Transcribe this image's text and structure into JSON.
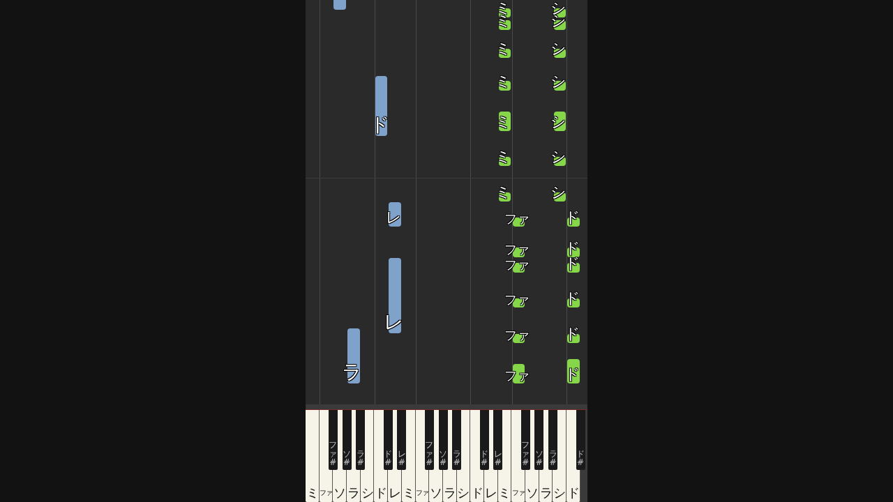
{
  "piano_roll": {
    "notes": [
      {
        "color": "#7fa2cb"
      },
      {
        "color": "#7fa2cb",
        "label": "ド"
      },
      {
        "color": "#7fa2cb",
        "label": "レ"
      },
      {
        "color": "#7fa2cb",
        "label": "レ"
      },
      {
        "color": "#7fa2cb",
        "label": "ラ"
      },
      {
        "color": "#86d64a",
        "label": "ミ"
      },
      {
        "color": "#86d64a",
        "label": "ミ"
      },
      {
        "color": "#86d64a",
        "label": "ミ"
      },
      {
        "color": "#86d64a",
        "label": "ミ"
      },
      {
        "color": "#86d64a",
        "label": "ミ"
      },
      {
        "color": "#86d64a",
        "label": "ミ"
      },
      {
        "color": "#86d64a",
        "label": "ミ"
      },
      {
        "color": "#86d64a",
        "label": "シ"
      },
      {
        "color": "#86d64a",
        "label": "シ"
      },
      {
        "color": "#86d64a",
        "label": "シ"
      },
      {
        "color": "#86d64a",
        "label": "シ"
      },
      {
        "color": "#86d64a",
        "label": "シ"
      },
      {
        "color": "#86d64a",
        "label": "シ"
      },
      {
        "color": "#86d64a",
        "label": "シ"
      },
      {
        "color": "#86d64a",
        "label": "ファ"
      },
      {
        "color": "#86d64a",
        "label": "ファ"
      },
      {
        "color": "#86d64a",
        "label": "ファ"
      },
      {
        "color": "#86d64a",
        "label": "ファ"
      },
      {
        "color": "#86d64a",
        "label": "ファ"
      },
      {
        "color": "#86d64a",
        "label": "ファ"
      },
      {
        "color": "#86d64a",
        "label": "ド"
      },
      {
        "color": "#86d64a",
        "label": "ド"
      },
      {
        "color": "#86d64a",
        "label": "ド"
      },
      {
        "color": "#86d64a",
        "label": "ド"
      },
      {
        "color": "#86d64a",
        "label": "ド"
      },
      {
        "color": "#86d64a",
        "label": "ド"
      }
    ]
  },
  "keyboard": {
    "white_keys": [
      {
        "label": "ミ"
      },
      {
        "label": "ファ",
        "sharp": {
          "label": "ファ#"
        }
      },
      {
        "label": "ソ",
        "sharp": {
          "label": "ソ#"
        }
      },
      {
        "label": "ラ",
        "sharp": {
          "label": "ラ#"
        }
      },
      {
        "label": "シ"
      },
      {
        "label": "ド",
        "sharp": {
          "label": "ド#"
        }
      },
      {
        "label": "レ",
        "sharp": {
          "label": "レ#"
        }
      },
      {
        "label": "ミ"
      },
      {
        "label": "ファ",
        "sharp": {
          "label": "ファ#"
        }
      },
      {
        "label": "ソ",
        "sharp": {
          "label": "ソ#"
        }
      },
      {
        "label": "ラ",
        "sharp": {
          "label": "ラ#"
        }
      },
      {
        "label": "シ"
      },
      {
        "label": "ド",
        "sharp": {
          "label": "ド#"
        }
      },
      {
        "label": "レ",
        "sharp": {
          "label": "レ#"
        }
      },
      {
        "label": "ミ"
      },
      {
        "label": "ファ",
        "sharp": {
          "label": "ファ#"
        }
      },
      {
        "label": "ソ",
        "sharp": {
          "label": "ソ#"
        }
      },
      {
        "label": "ラ",
        "sharp": {
          "label": "ラ#"
        }
      },
      {
        "label": "シ"
      },
      {
        "label": "ド",
        "sharp": {
          "label": "ド#"
        }
      }
    ]
  }
}
